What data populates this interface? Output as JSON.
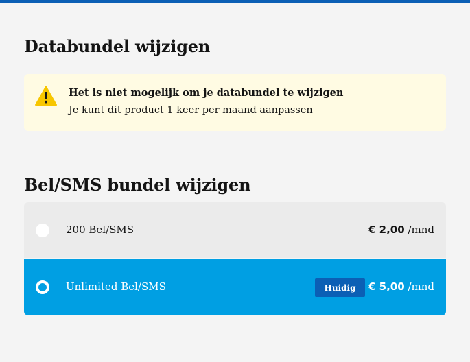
{
  "colors": {
    "topbar": "#0b5fb5",
    "notice_bg": "#fffbe3",
    "warning_yellow": "#f7c600",
    "option_bg": "#ebebeb",
    "selected_bg": "#009fe3",
    "badge_bg": "#0b5fb5"
  },
  "data_section": {
    "heading": "Databundel wijzigen",
    "notice": {
      "icon": "warning-icon",
      "title": "Het is niet mogelijk om je databundel te wijzigen",
      "text": "Je kunt dit product 1 keer per maand aanpassen"
    }
  },
  "call_section": {
    "heading": "Bel/SMS bundel wijzigen",
    "options": [
      {
        "label": "200 Bel/SMS",
        "price": "€ 2,00",
        "period": "/mnd",
        "selected": false
      },
      {
        "label": "Unlimited Bel/SMS",
        "price": "€ 5,00",
        "period": "/mnd",
        "selected": true,
        "badge": "Huidig"
      }
    ]
  }
}
